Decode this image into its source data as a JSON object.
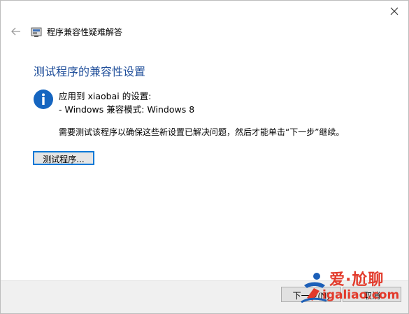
{
  "window": {
    "title": "程序兼容性疑难解答"
  },
  "content": {
    "heading": "测试程序的兼容性设置",
    "info_line1": "应用到 xiaobai 的设置:",
    "info_line2": "- Windows 兼容模式: Windows 8",
    "message": "需要测试该程序以确保这些新设置已解决问题，然后才能单击“下一步”继续。",
    "test_button_label": "测试程序..."
  },
  "footer": {
    "next_label": "下一步(N)",
    "cancel_label": "取消"
  },
  "watermark": {
    "line1": "爱·尬聊",
    "line2": "igaliao.com"
  },
  "colors": {
    "heading": "#1f4e9a",
    "info_icon": "#1565c0",
    "focus_border": "#0078d7",
    "footer_bg": "#f0f0f0",
    "watermark": "#e23a2b"
  },
  "icons": {
    "close": "close-icon",
    "back": "back-arrow-icon",
    "app": "troubleshooter-icon",
    "info": "info-icon"
  }
}
